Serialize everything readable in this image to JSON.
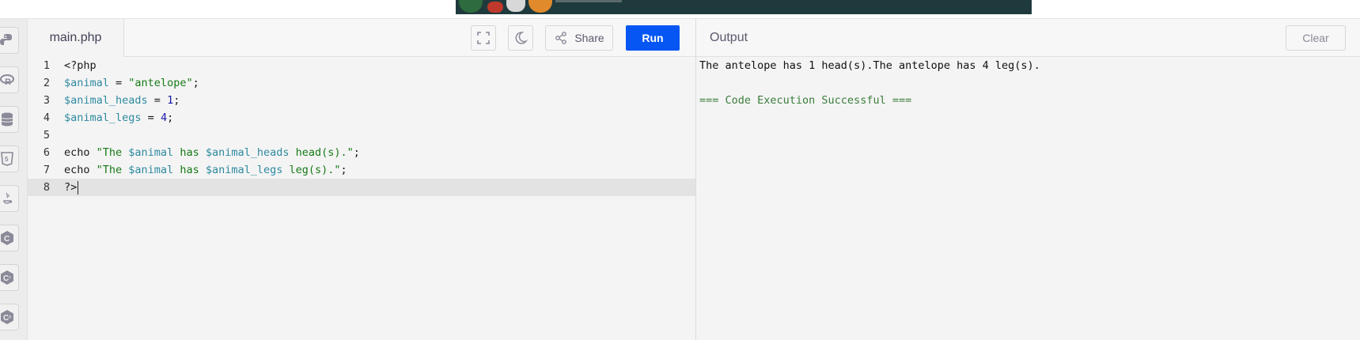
{
  "editor": {
    "file_tab": "main.php",
    "share_label": "Share",
    "run_label": "Run",
    "icons": [
      "fullscreen-icon",
      "moon-icon",
      "share-icon"
    ]
  },
  "sidebar": {
    "languages": [
      "python",
      "r",
      "sql",
      "html",
      "java",
      "c",
      "cpp",
      "csharp"
    ]
  },
  "code": {
    "line_numbers": [
      "1",
      "2",
      "3",
      "4",
      "5",
      "6",
      "7",
      "8"
    ],
    "l1": "<?php",
    "l2_var": "$animal",
    "l2_op": " = ",
    "l2_str": "\"antelope\"",
    "l2_end": ";",
    "l3_var": "$animal_heads",
    "l3_op": " = ",
    "l3_num": "1",
    "l3_end": ";",
    "l4_var": "$animal_legs",
    "l4_op": " = ",
    "l4_num": "4",
    "l4_end": ";",
    "l6_echo": "echo ",
    "l6_s1": "\"The ",
    "l6_v1": "$animal",
    "l6_s2": " has ",
    "l6_v2": "$animal_heads",
    "l6_s3": " head(s).\"",
    "l6_end": ";",
    "l7_echo": "echo ",
    "l7_s1": "\"The ",
    "l7_v1": "$animal",
    "l7_s2": " has ",
    "l7_v2": "$animal_legs",
    "l7_s3": " leg(s).\"",
    "l7_end": ";",
    "l8": "?>"
  },
  "output": {
    "title": "Output",
    "clear_label": "Clear",
    "result": "The antelope has 1 head(s).The antelope has 4 leg(s).",
    "status": "=== Code Execution Successful ==="
  },
  "colors": {
    "run_button": "#0556f3",
    "variable": "#2e8aa0",
    "string": "#167a16",
    "number": "#1a1aa6",
    "success": "#3a7d3a"
  }
}
